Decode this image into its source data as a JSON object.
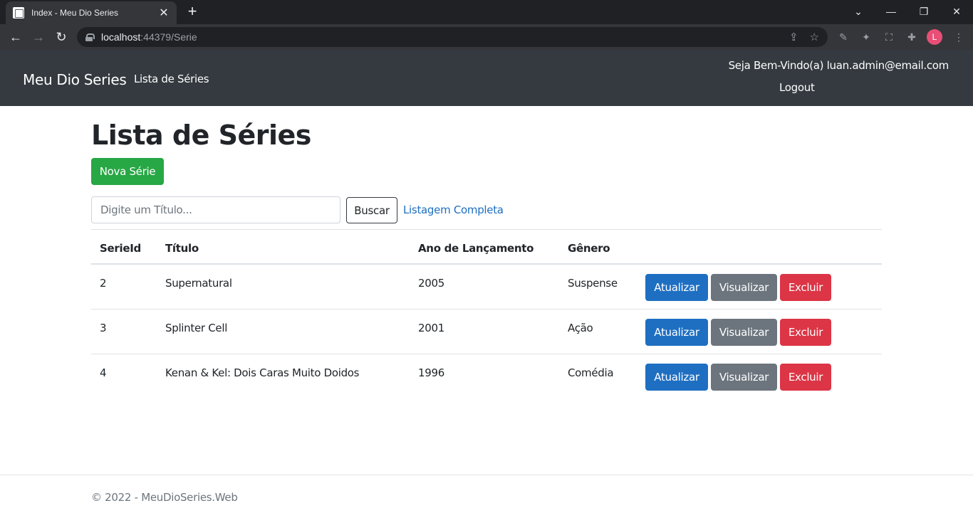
{
  "browser": {
    "tab_title": "Index - Meu Dio Series",
    "url_host": "localhost",
    "url_path": ":44379/Serie",
    "profile_initial": "L"
  },
  "navbar": {
    "brand": "Meu Dio Series",
    "link_lista": "Lista de Séries",
    "welcome": "Seja Bem-Vindo(a) luan.admin@email.com",
    "logout": "Logout"
  },
  "main": {
    "title": "Lista de Séries",
    "new_button": "Nova Série",
    "search_placeholder": "Digite um Título...",
    "search_button": "Buscar",
    "full_list_link": "Listagem Completa"
  },
  "table": {
    "headers": [
      "SerieId",
      "Título",
      "Ano de Lançamento",
      "Gênero"
    ],
    "rows": [
      {
        "id": "2",
        "titulo": "Supernatural",
        "ano": "2005",
        "genero": "Suspense"
      },
      {
        "id": "3",
        "titulo": "Splinter Cell",
        "ano": "2001",
        "genero": "Ação"
      },
      {
        "id": "4",
        "titulo": "Kenan & Kel: Dois Caras Muito Doidos",
        "ano": "1996",
        "genero": "Comédia"
      }
    ],
    "actions": {
      "update": "Atualizar",
      "view": "Visualizar",
      "delete": "Excluir"
    }
  },
  "footer": {
    "text": "© 2022 - MeuDioSeries.Web"
  },
  "colors": {
    "navbar_bg": "#343a40",
    "success": "#28a745",
    "primary": "#1e6fc2",
    "secondary": "#6c757d",
    "danger": "#dc3545"
  }
}
